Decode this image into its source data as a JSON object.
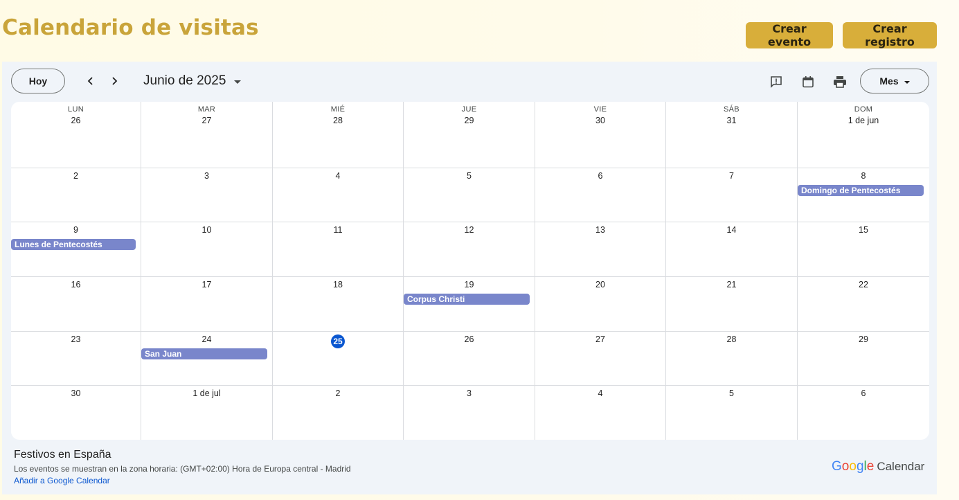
{
  "header": {
    "title": "Calendario de visitas",
    "buttons": {
      "crear_evento": "Crear evento",
      "crear_registro": "Crear registro"
    }
  },
  "toolbar": {
    "today": "Hoy",
    "month_label": "Junio de 2025",
    "view": "Mes"
  },
  "weekdays": [
    "LUN",
    "MAR",
    "MIÉ",
    "JUE",
    "VIE",
    "SÁB",
    "DOM"
  ],
  "weeks": [
    [
      "26",
      "27",
      "28",
      "29",
      "30",
      "31",
      "1 de jun"
    ],
    [
      "2",
      "3",
      "4",
      "5",
      "6",
      "7",
      "8"
    ],
    [
      "9",
      "10",
      "11",
      "12",
      "13",
      "14",
      "15"
    ],
    [
      "16",
      "17",
      "18",
      "19",
      "20",
      "21",
      "22"
    ],
    [
      "23",
      "24",
      "25",
      "26",
      "27",
      "28",
      "29"
    ],
    [
      "30",
      "1 de jul",
      "2",
      "3",
      "4",
      "5",
      "6"
    ]
  ],
  "today": {
    "week": 4,
    "day": 2
  },
  "events": [
    {
      "title": "Domingo de Pentecostés",
      "week": 1,
      "day": 6
    },
    {
      "title": "Lunes de Pentecostés",
      "week": 2,
      "day": 0
    },
    {
      "title": "Corpus Christi",
      "week": 3,
      "day": 3
    },
    {
      "title": "San Juan",
      "week": 4,
      "day": 1
    }
  ],
  "colors": {
    "event": "#7986cb",
    "today": "#0b57d0",
    "accent": "#d8ae3a",
    "title": "#c9a43a"
  },
  "footer": {
    "calendar_name": "Festivos en España",
    "timezone": "Los eventos se muestran en la zona horaria: (GMT+02:00) Hora de Europa central - Madrid",
    "add_link": "Añadir a Google Calendar",
    "brand": "Google",
    "product": "Calendar"
  }
}
